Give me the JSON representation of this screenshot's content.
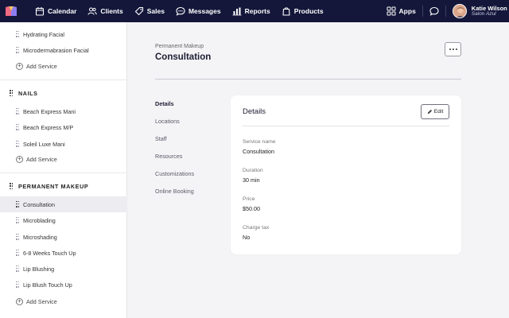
{
  "nav": {
    "items": [
      {
        "label": "Calendar",
        "icon": "calendar-icon"
      },
      {
        "label": "Clients",
        "icon": "users-icon"
      },
      {
        "label": "Sales",
        "icon": "tag-icon"
      },
      {
        "label": "Messages",
        "icon": "chat-icon"
      },
      {
        "label": "Reports",
        "icon": "bar-chart-icon"
      },
      {
        "label": "Products",
        "icon": "bag-icon"
      }
    ],
    "apps_label": "Apps",
    "user_name": "Katie Wilson",
    "user_location": "Salon Azul",
    "colors": {
      "bar": "#14173a",
      "logo_left": "#e85d75",
      "logo_right": "#7d6bf0"
    }
  },
  "sidebar": {
    "facial_items": [
      "Hydrating Facial",
      "Microdermabrasion Facial"
    ],
    "add_service_label": "Add Service",
    "nails_category": "NAILS",
    "nails_items": [
      "Beach Express Mani",
      "Beach Express M/P",
      "Soleil Luxe Mani"
    ],
    "makeup_category": "PERMANENT MAKEUP",
    "makeup_items": [
      "Consultation",
      "Microblading",
      "Microshading",
      "6-8 Weeks Touch Up",
      "Lip Blushing",
      "Lip Blush Touch Up"
    ]
  },
  "main": {
    "breadcrumb": "Permanent Makeup",
    "title": "Consultation",
    "subnav": [
      "Details",
      "Locations",
      "Staff",
      "Resources",
      "Customizations",
      "Online Booking"
    ],
    "card": {
      "title": "Details",
      "edit_label": "Edit",
      "fields": [
        {
          "label": "Service name",
          "value": "Consultation"
        },
        {
          "label": "Duration",
          "value": "30 min"
        },
        {
          "label": "Price",
          "value": "$50.00"
        },
        {
          "label": "Charge tax",
          "value": "No"
        }
      ]
    }
  }
}
